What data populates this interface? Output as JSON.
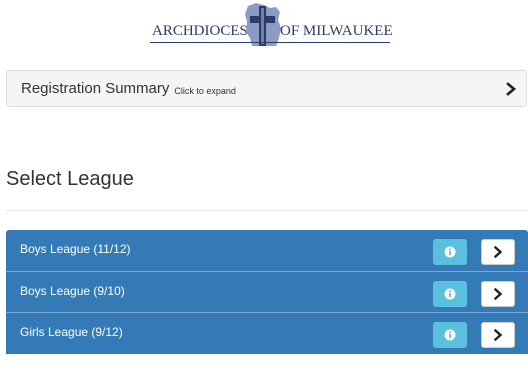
{
  "header": {
    "logo_left": "ARCHDIOCESE",
    "logo_right": "OF MILWAUKEE",
    "logo_icon": "wisconsin-map-cross-icon"
  },
  "summary": {
    "title": "Registration Summary",
    "hint": "Click to expand",
    "icon": "chevron-right-icon"
  },
  "main": {
    "heading": "Select League",
    "leagues": [
      {
        "label": "Boys League (11/12)",
        "info_icon": "info-icon",
        "go_icon": "chevron-right-icon"
      },
      {
        "label": "Boys League (9/10)",
        "info_icon": "info-icon",
        "go_icon": "chevron-right-icon"
      },
      {
        "label": "Girls League (9/12)",
        "info_icon": "info-icon",
        "go_icon": "chevron-right-icon"
      }
    ]
  },
  "colors": {
    "primary": "#337ab7",
    "info": "#5bc0de",
    "logo": "#2b3b6b",
    "panel": "#f5f5f5"
  }
}
